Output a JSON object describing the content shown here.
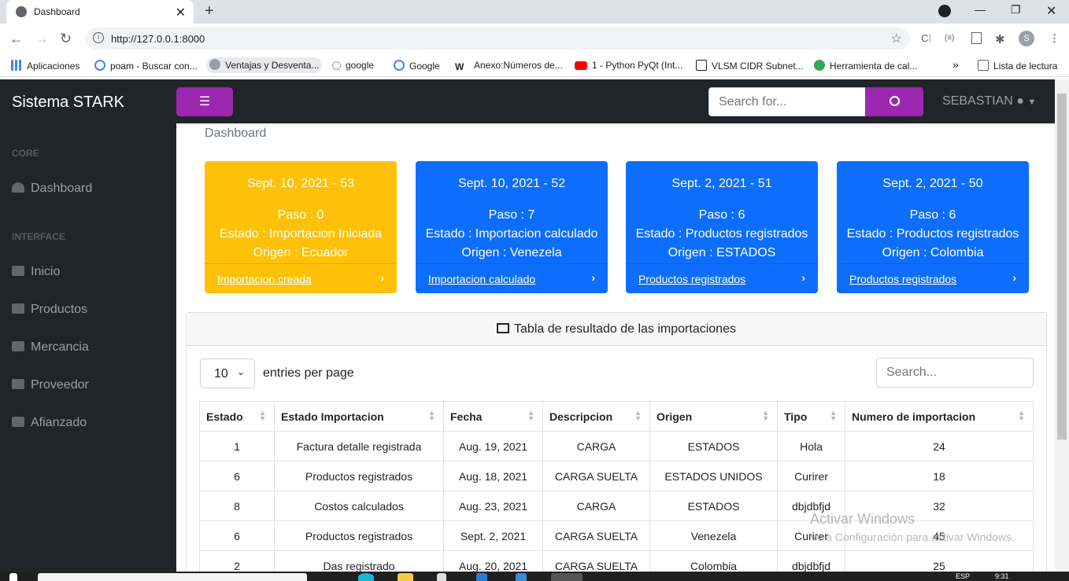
{
  "browser": {
    "tab_title": "Dashboard",
    "url": "http://127.0.0.1:8000",
    "profile_initial": "S",
    "bookmarks": [
      {
        "label": "Aplicaciones",
        "color": "#4285f4"
      },
      {
        "label": "poam - Buscar con...",
        "color": "#4285f4"
      },
      {
        "label": "Ventajas y Desventa...",
        "color": "#9aa0a6"
      },
      {
        "label": "google",
        "color": "#9aa0a6"
      },
      {
        "label": "Google",
        "color": "#4285f4"
      },
      {
        "label": "Anexo:Números de...",
        "color": "#202124"
      },
      {
        "label": "1 - Python PyQt (Int...",
        "color": "#ff0000"
      },
      {
        "label": "VLSM CIDR Subnet...",
        "color": "#202124"
      },
      {
        "label": "Herramienta de cal...",
        "color": "#34a853"
      },
      {
        "label": "Lista de lectura",
        "color": "#5f6368"
      }
    ]
  },
  "navbar": {
    "brand": "Sistema STARK",
    "search_placeholder": "Search for...",
    "user": "SEBASTIAN"
  },
  "sidebar": {
    "heading_core": "CORE",
    "heading_interface": "INTERFACE",
    "items": [
      {
        "label": "Dashboard"
      },
      {
        "label": "Inicio"
      },
      {
        "label": "Productos"
      },
      {
        "label": "Mercancia"
      },
      {
        "label": "Proveedor"
      },
      {
        "label": "Afianzado"
      }
    ]
  },
  "breadcrumb": "Dashboard",
  "cards": [
    {
      "title": "Sept. 10, 2021 - 53",
      "paso": "Paso : 0",
      "estado": "Estado : Importacion Iniciada",
      "origen": "Origen : Ecuador",
      "link": "Importacion creada",
      "color": "#ffc107"
    },
    {
      "title": "Sept. 10, 2021 - 52",
      "paso": "Paso : 7",
      "estado": "Estado : Importacion calculado",
      "origen": "Origen : Venezela",
      "link": "Importacion calculado",
      "color": "#0d6efd"
    },
    {
      "title": "Sept. 2, 2021 - 51",
      "paso": "Paso : 6",
      "estado": "Estado : Productos registrados",
      "origen": "Origen : ESTADOS",
      "link": "Productos registrados",
      "color": "#0d6efd"
    },
    {
      "title": "Sept. 2, 2021 - 50",
      "paso": "Paso : 6",
      "estado": "Estado : Productos registrados",
      "origen": "Origen : Colombia",
      "link": "Productos registrados",
      "color": "#0d6efd"
    }
  ],
  "table_card": {
    "title": "Tabla de resultado de las importaciones",
    "entries_value": "10",
    "entries_label": "entries per page",
    "search_placeholder": "Search...",
    "columns": [
      "Estado",
      "Estado Importacion",
      "Fecha",
      "Descripcion",
      "Origen",
      "Tipo",
      "Numero de importacion"
    ],
    "rows": [
      [
        "1",
        "Factura detalle registrada",
        "Aug. 19, 2021",
        "CARGA",
        "ESTADOS",
        "Hola",
        "24"
      ],
      [
        "6",
        "Productos registrados",
        "Aug. 18, 2021",
        "CARGA SUELTA",
        "ESTADOS UNIDOS",
        "Curirer",
        "18"
      ],
      [
        "8",
        "Costos calculados",
        "Aug. 23, 2021",
        "CARGA",
        "ESTADOS",
        "dbjdbfjd",
        "32"
      ],
      [
        "6",
        "Productos registrados",
        "Sept. 2, 2021",
        "CARGA SUELTA",
        "Venezela",
        "Curirer",
        "45"
      ],
      [
        "2",
        "Das registrado",
        "Aug. 20, 2021",
        "CARGA SUELTA",
        "Colombia",
        "dbjdbfjd",
        "25"
      ]
    ]
  },
  "watermark": {
    "line1": "Activar Windows",
    "line2": "Ve a Configuración para activar Windows."
  },
  "taskbar": {
    "lang": "ESP",
    "time": "9:31"
  }
}
